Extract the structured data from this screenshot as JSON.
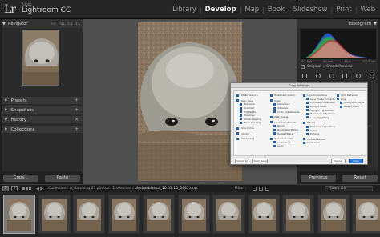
{
  "app": {
    "logo": "Lr",
    "brand_small": "Adobe",
    "brand_name": "Lightroom CC"
  },
  "modules": [
    {
      "label": "Library",
      "active": false
    },
    {
      "label": "Develop",
      "active": true
    },
    {
      "label": "Map",
      "active": false
    },
    {
      "label": "Book",
      "active": false
    },
    {
      "label": "Slideshow",
      "active": false
    },
    {
      "label": "Print",
      "active": false
    },
    {
      "label": "Web",
      "active": false
    }
  ],
  "left_panel": {
    "navigator_title": "Navigator",
    "zooms": [
      "FIT",
      "FILL",
      "1:1",
      "3:1"
    ],
    "sections": [
      "Presets",
      "Snapshots",
      "History",
      "Collections"
    ],
    "copy_label": "Copy...",
    "paste_label": "Paste"
  },
  "right_panel": {
    "histogram_title": "Histogram",
    "histo_info": [
      "ISO 400",
      "50 mm",
      "f/5.6",
      "1/320 sec"
    ],
    "smart_preview_label": "Original + Smart Preview",
    "previous_label": "Previous",
    "reset_label": "Reset"
  },
  "dialog": {
    "title": "Copy Settings",
    "columns": [
      [
        {
          "label": "White Balance",
          "sub": false,
          "gap": false
        },
        {
          "label": "Basic Tone",
          "sub": false,
          "gap": true
        },
        {
          "label": "Exposure",
          "sub": true,
          "gap": false
        },
        {
          "label": "Contrast",
          "sub": true,
          "gap": false
        },
        {
          "label": "Highlights",
          "sub": true,
          "gap": false
        },
        {
          "label": "Shadows",
          "sub": true,
          "gap": false
        },
        {
          "label": "White Clipping",
          "sub": true,
          "gap": false
        },
        {
          "label": "Black Clipping",
          "sub": true,
          "gap": false
        },
        {
          "label": "Tone Curve",
          "sub": false,
          "gap": true
        },
        {
          "label": "Clarity",
          "sub": false,
          "gap": true
        },
        {
          "label": "Sharpening",
          "sub": false,
          "gap": true
        }
      ],
      [
        {
          "label": "Treatment (Color)",
          "sub": false,
          "gap": false
        },
        {
          "label": "Color",
          "sub": false,
          "gap": true
        },
        {
          "label": "Saturation",
          "sub": true,
          "gap": false
        },
        {
          "label": "Vibrance",
          "sub": true,
          "gap": false
        },
        {
          "label": "Color Adjustments",
          "sub": true,
          "gap": false
        },
        {
          "label": "Split Toning",
          "sub": false,
          "gap": true
        },
        {
          "label": "Local Adjustments",
          "sub": false,
          "gap": true
        },
        {
          "label": "Brush",
          "sub": true,
          "gap": false
        },
        {
          "label": "Graduated Filters",
          "sub": true,
          "gap": false
        },
        {
          "label": "Radial Filters",
          "sub": true,
          "gap": false
        },
        {
          "label": "Noise Reduction",
          "sub": false,
          "gap": true
        },
        {
          "label": "Luminance",
          "sub": true,
          "gap": false
        },
        {
          "label": "Color",
          "sub": true,
          "gap": false
        }
      ],
      [
        {
          "label": "Lens Corrections",
          "sub": false,
          "gap": false
        },
        {
          "label": "Lens Profile Corrections",
          "sub": true,
          "gap": false
        },
        {
          "label": "Chromatic Aberration",
          "sub": true,
          "gap": false
        },
        {
          "label": "Upright Mode",
          "sub": true,
          "gap": false
        },
        {
          "label": "Upright Transforms",
          "sub": true,
          "gap": false
        },
        {
          "label": "Transform Adjustments",
          "sub": true,
          "gap": false
        },
        {
          "label": "Lens Vignetting",
          "sub": true,
          "gap": false
        },
        {
          "label": "Effects",
          "sub": false,
          "gap": true
        },
        {
          "label": "Post-Crop Vignetting",
          "sub": true,
          "gap": false
        },
        {
          "label": "Grain",
          "sub": true,
          "gap": false
        },
        {
          "label": "Dehaze",
          "sub": true,
          "gap": false
        },
        {
          "label": "Process Version",
          "sub": false,
          "gap": true
        },
        {
          "label": "Calibration",
          "sub": false,
          "gap": false
        }
      ],
      [
        {
          "label": "Spot Removal",
          "sub": false,
          "gap": false
        },
        {
          "label": "Crop",
          "sub": false,
          "gap": false
        },
        {
          "label": "Straighten Angle",
          "sub": true,
          "gap": false
        },
        {
          "label": "Aspect Ratio",
          "sub": true,
          "gap": false
        }
      ]
    ],
    "check_all": "Check All",
    "check_none": "Check None",
    "cancel": "Cancel",
    "copy": "Copy"
  },
  "filmstrip_bar": {
    "pages": [
      "1",
      "2"
    ],
    "path_prefix": "Collection : A_Batching",
    "path_count": "21 photos / 1 selected /",
    "path_file": "piedrasblanca_10.01.16_0487.dng",
    "filter_label": "Filter :",
    "filter_value": "Filters Off"
  },
  "colors": {
    "accent": "#2f7bd6",
    "panel": "#2b2b2b",
    "background": "#4f4f4f"
  }
}
